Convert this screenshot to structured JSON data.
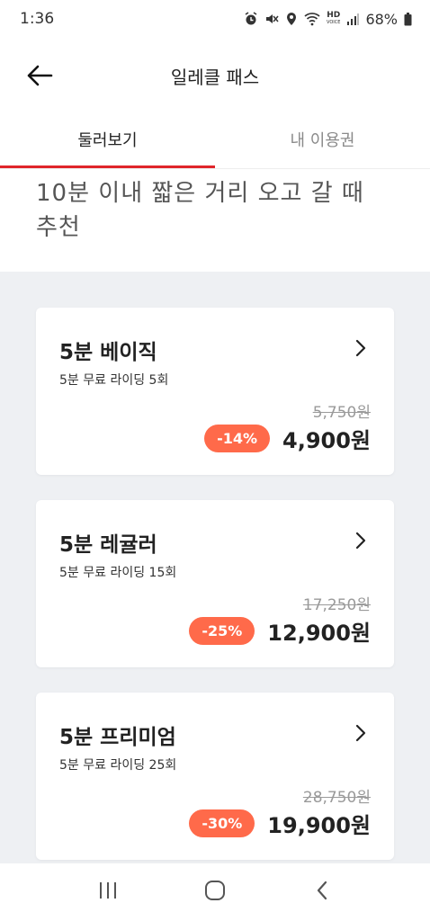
{
  "status_bar": {
    "time": "1:36",
    "battery": "68%",
    "hd_label": "HD",
    "hd_sub": "VOICE"
  },
  "header": {
    "title": "일레클 패스",
    "back_icon": "arrow-left-icon"
  },
  "tabs": [
    {
      "label": "둘러보기",
      "active": true
    },
    {
      "label": "내 이용권",
      "active": false
    }
  ],
  "description": "10분 이내 짧은 거리 오고 갈 때 추천",
  "passes": [
    {
      "name": "5분 베이직",
      "desc": "5분 무료 라이딩 5회",
      "original_price": "5,750원",
      "discount": "-14%",
      "price": "4,900원"
    },
    {
      "name": "5분 레귤러",
      "desc": "5분 무료 라이딩 15회",
      "original_price": "17,250원",
      "discount": "-25%",
      "price": "12,900원"
    },
    {
      "name": "5분 프리미엄",
      "desc": "5분 무료 라이딩 25회",
      "original_price": "28,750원",
      "discount": "-30%",
      "price": "19,900원"
    }
  ],
  "colors": {
    "accent": "#e0252b",
    "badge": "#ff6a4a",
    "list_bg": "#eef0f3"
  },
  "nav_bar": {
    "recent_icon": "recent-apps-icon",
    "home_icon": "home-icon",
    "back_icon": "back-chevron-icon"
  }
}
